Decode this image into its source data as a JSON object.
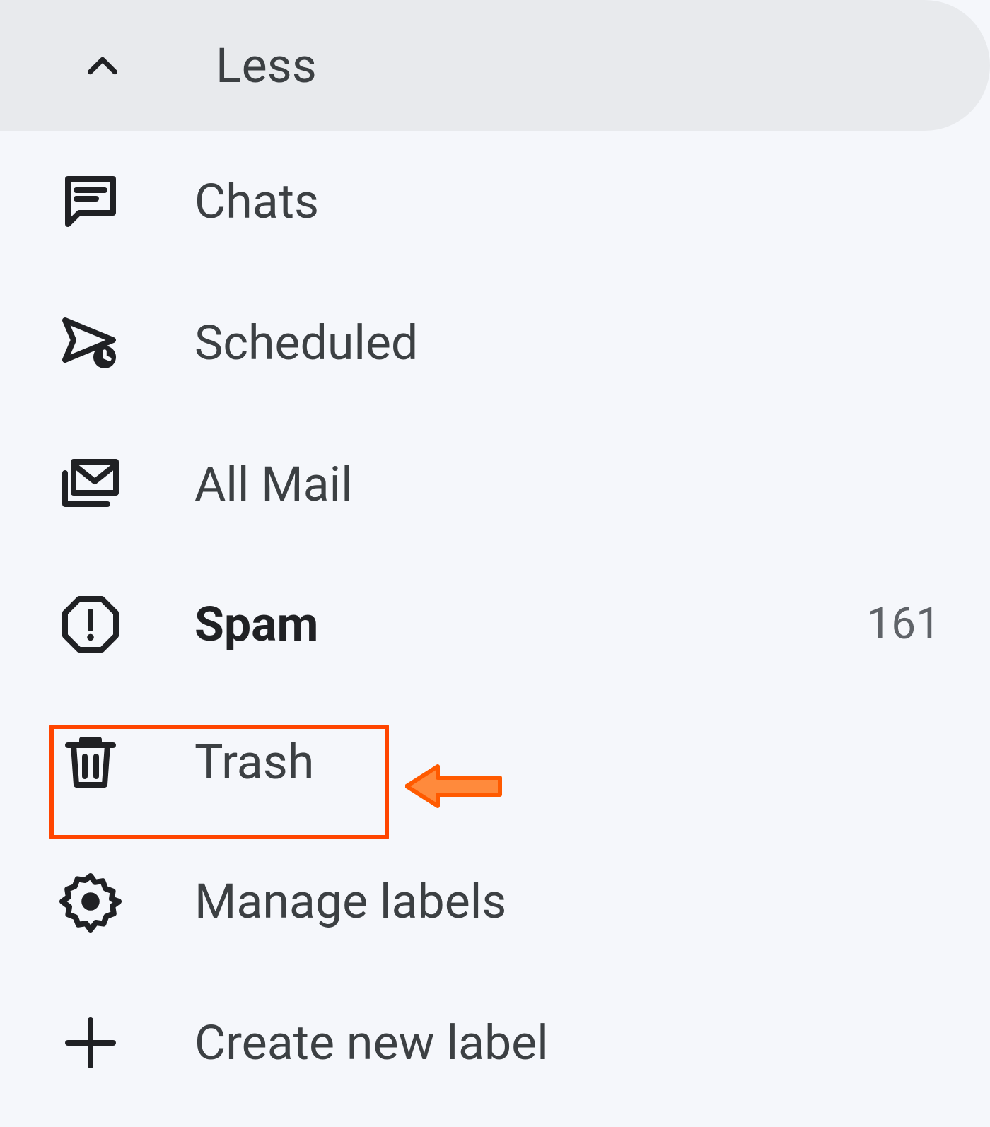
{
  "sidebar": {
    "less_label": "Less",
    "items": [
      {
        "key": "chats",
        "label": "Chats",
        "icon": "chat-icon",
        "bold": false,
        "count": null
      },
      {
        "key": "scheduled",
        "label": "Scheduled",
        "icon": "scheduled-icon",
        "bold": false,
        "count": null
      },
      {
        "key": "allmail",
        "label": "All Mail",
        "icon": "all-mail-icon",
        "bold": false,
        "count": null
      },
      {
        "key": "spam",
        "label": "Spam",
        "icon": "spam-icon",
        "bold": true,
        "count": "161"
      },
      {
        "key": "trash",
        "label": "Trash",
        "icon": "trash-icon",
        "bold": false,
        "count": null,
        "highlighted": true
      },
      {
        "key": "manage",
        "label": "Manage labels",
        "icon": "gear-icon",
        "bold": false,
        "count": null
      },
      {
        "key": "create",
        "label": "Create new label",
        "icon": "plus-icon",
        "bold": false,
        "count": null
      }
    ]
  }
}
